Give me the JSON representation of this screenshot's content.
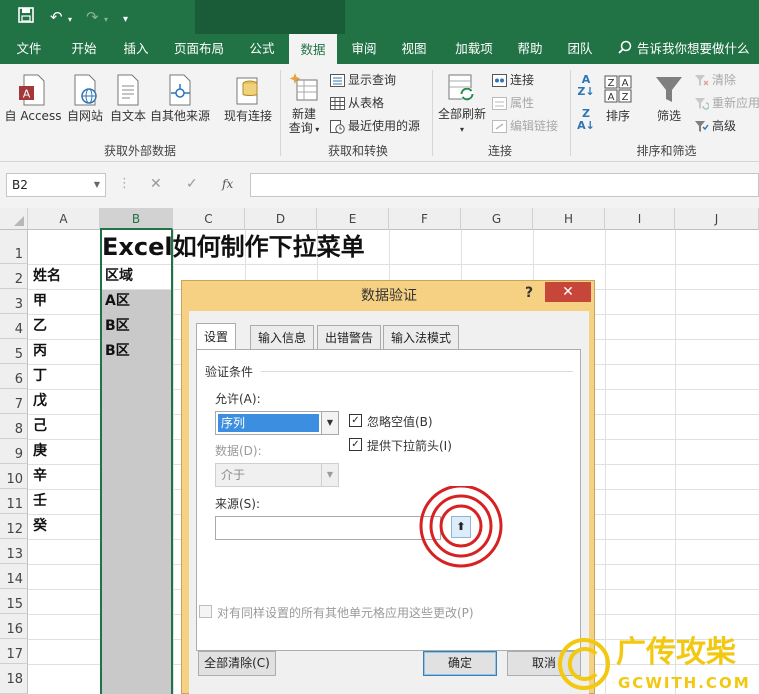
{
  "window": {
    "file_name": ""
  },
  "menu_tabs": [
    "文件",
    "开始",
    "插入",
    "页面布局",
    "公式",
    "数据",
    "审阅",
    "视图",
    "加载项",
    "帮助",
    "团队"
  ],
  "active_tab": "数据",
  "search_hint": "告诉我你想要做什么",
  "ribbon": {
    "get_external": {
      "label": "获取外部数据",
      "buttons": [
        "自 Access",
        "自网站",
        "自文本",
        "自其他来源",
        "现有连接"
      ]
    },
    "get_transform": {
      "label": "获取和转换",
      "new_query_1": "新建",
      "new_query_2": "查询",
      "small": [
        "显示查询",
        "从表格",
        "最近使用的源"
      ]
    },
    "connections": {
      "label": "连接",
      "refresh_all": "全部刷新",
      "small": [
        "连接",
        "属性",
        "编辑链接"
      ]
    },
    "sort_filter": {
      "label": "排序和筛选",
      "sort": "排序",
      "filter": "筛选",
      "small": [
        "清除",
        "重新应用",
        "高级"
      ]
    }
  },
  "formula_bar": {
    "name_box": "B2",
    "cancel": "✕",
    "enter": "✓",
    "fx": "fx",
    "formula": ""
  },
  "columns": [
    "A",
    "B",
    "C",
    "D",
    "E",
    "F",
    "G",
    "H",
    "I",
    "J"
  ],
  "rows": [
    "1",
    "2",
    "3",
    "4",
    "5",
    "6",
    "7",
    "8",
    "9",
    "10",
    "11",
    "12",
    "13",
    "14",
    "15",
    "16",
    "17",
    "18"
  ],
  "sheet": {
    "title": "Excel如何制作下拉菜单",
    "col_a": [
      "姓名",
      "甲",
      "乙",
      "丙",
      "丁",
      "戊",
      "己",
      "庚",
      "辛",
      "壬",
      "癸"
    ],
    "col_b": [
      "区域",
      "A区",
      "B区",
      "B区"
    ]
  },
  "dialog": {
    "title": "数据验证",
    "help": "?",
    "tabs": [
      "设置",
      "输入信息",
      "出错警告",
      "输入法模式"
    ],
    "section": "验证条件",
    "allow_label": "允许(A):",
    "allow_value": "序列",
    "data_label": "数据(D):",
    "data_value": "介于",
    "ignore_blank": "忽略空值(B)",
    "dropdown_arrow": "提供下拉箭头(I)",
    "source_label": "来源(S):",
    "source_value": "",
    "apply_all": "对有同样设置的所有其他单元格应用这些更改(P)",
    "clear_all": "全部清除(C)",
    "ok": "确定",
    "cancel": "取消"
  },
  "watermark": {
    "brand": "广传攻柴",
    "domain": "GCWITH.COM"
  }
}
